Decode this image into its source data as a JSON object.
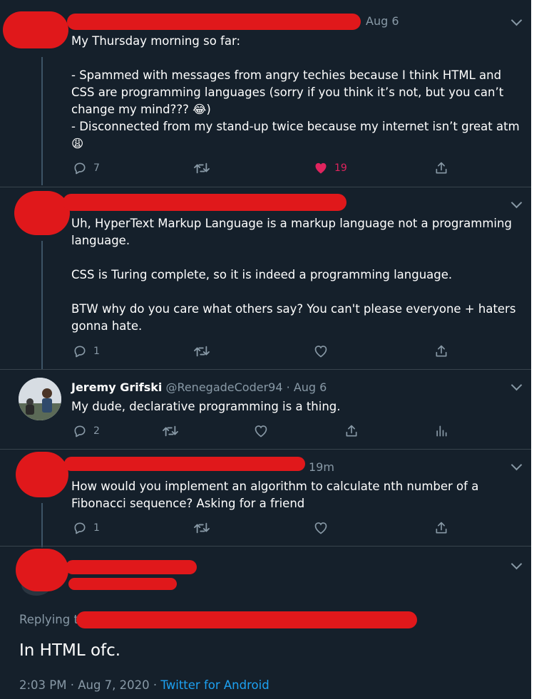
{
  "tweet1": {
    "date": "Aug 6",
    "body": "My Thursday morning so far:\n\n- Spammed with messages from angry techies because I think HTML and CSS are programming languages (sorry if you think it’s not, but you can’t change my mind??? 😂)\n- Disconnected from my stand-up twice because my internet isn’t great atm\n😩",
    "replies": "7",
    "likes": "19"
  },
  "tweet2": {
    "body": "Uh, HyperText Markup Language is a markup language not a programming language.\n\nCSS is Turing complete, so it is indeed a programming language.\n\nBTW why do you care what others say? You can't please everyone + haters gonna hate.",
    "replies": "1"
  },
  "tweet3": {
    "name": "Jeremy Grifski",
    "handle": "@RenegadeCoder94",
    "sep": "·",
    "date": "Aug 6",
    "body": "My dude, declarative programming is a thing.",
    "replies": "2"
  },
  "tweet4": {
    "time": "19m",
    "body": "How would you implement an algorithm to calculate nth number of a Fibonacci sequence? Asking for a friend",
    "replies": "1"
  },
  "tweet5": {
    "replying_prefix": "Replying t",
    "body": "In HTML ofc.",
    "timestamp": "2:03 PM · Aug 7, 2020 ·",
    "source": "Twitter for Android"
  },
  "colors": {
    "background": "#15202b",
    "text": "#ffffff",
    "muted": "#8899a6",
    "link": "#1da1f2",
    "like": "#e0245e",
    "redaction": "#e0181b"
  },
  "icons": [
    "reply-icon",
    "retweet-icon",
    "like-icon",
    "share-icon",
    "analytics-icon",
    "chevron-down-icon"
  ]
}
